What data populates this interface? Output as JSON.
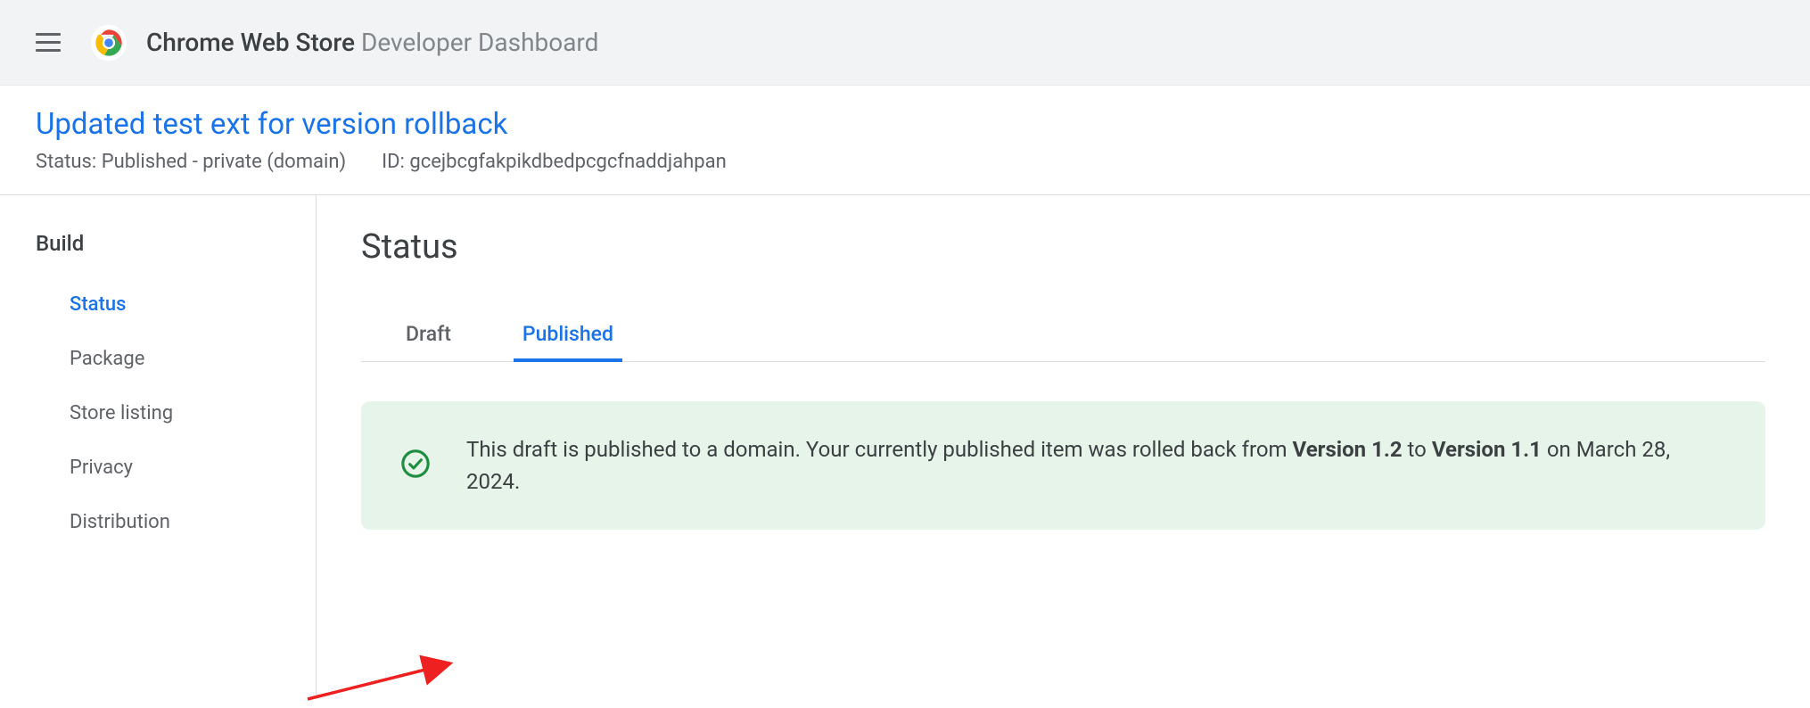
{
  "header": {
    "app_name_bold": "Chrome Web Store",
    "app_name_light": " Developer Dashboard"
  },
  "item": {
    "title": "Updated test ext for version rollback",
    "status_label": "Status: Published - private (domain)",
    "id_label": "ID: gcejbcgfakpikdbedpcgcfnaddjahpan"
  },
  "sidebar": {
    "section": "Build",
    "items": [
      {
        "label": "Status",
        "active": true
      },
      {
        "label": "Package",
        "active": false
      },
      {
        "label": "Store listing",
        "active": false
      },
      {
        "label": "Privacy",
        "active": false
      },
      {
        "label": "Distribution",
        "active": false
      }
    ]
  },
  "content": {
    "title": "Status",
    "tabs": [
      {
        "label": "Draft",
        "active": false
      },
      {
        "label": "Published",
        "active": true
      }
    ],
    "notice": {
      "pre": "This draft is published to a domain. Your currently published item was rolled back from ",
      "v_from": "Version 1.2",
      "mid": " to ",
      "v_to": "Version 1.1",
      "post": " on March 28, 2024."
    }
  }
}
